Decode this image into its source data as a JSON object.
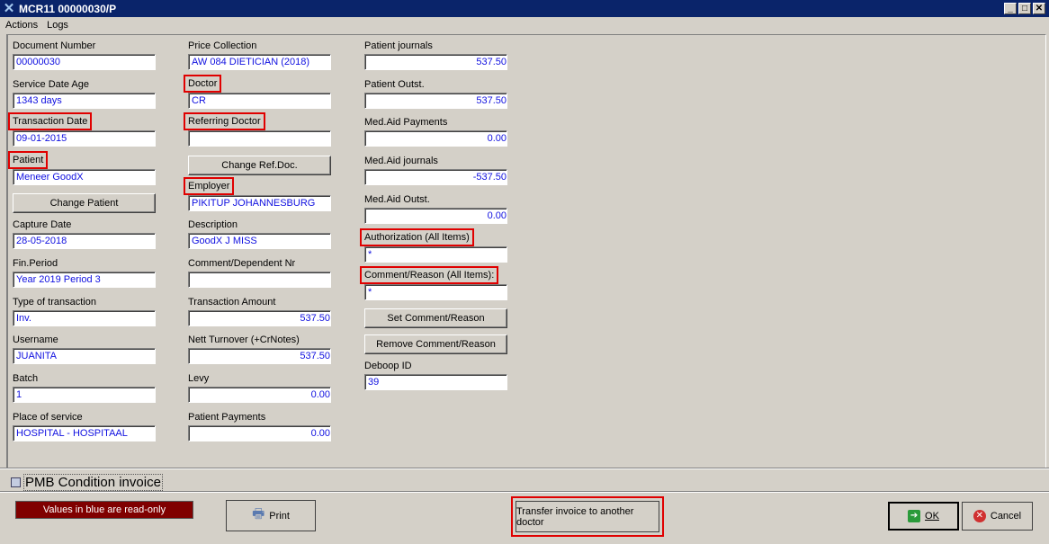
{
  "window": {
    "title": "MCR11 00000030/P",
    "minimize": "_",
    "restore": "□",
    "close": "✕"
  },
  "menu": [
    "Actions",
    "Logs"
  ],
  "col1": [
    {
      "label": "Document Number",
      "value": "00000030"
    },
    {
      "label": "Service Date Age",
      "value": "1343 days"
    },
    {
      "label": "Transaction Date",
      "value": "09-01-2015"
    },
    {
      "label": "Patient",
      "value": "Meneer GoodX"
    },
    {
      "label": "Capture Date",
      "value": "28-05-2018"
    },
    {
      "label": "Fin.Period",
      "value": "Year 2019 Period 3"
    },
    {
      "label": "Type of transaction",
      "value": "Inv."
    },
    {
      "label": "Username",
      "value": "JUANITA"
    },
    {
      "label": "Batch",
      "value": "1"
    },
    {
      "label": "Place of service",
      "value": "HOSPITAL - HOSPITAAL"
    }
  ],
  "col2": [
    {
      "label": "Price Collection",
      "value": "AW 084 DIETICIAN (2018)"
    },
    {
      "label": "Doctor",
      "value": "CR"
    },
    {
      "label": "Referring Doctor",
      "value": ""
    },
    {
      "label": "Employer",
      "value": "PIKITUP JOHANNESBURG"
    },
    {
      "label": "Description",
      "value": "GoodX J MISS"
    },
    {
      "label": "Comment/Dependent Nr",
      "value": ""
    },
    {
      "label": "Transaction Amount",
      "value": "537.50"
    },
    {
      "label": "Nett Turnover (+CrNotes)",
      "value": "537.50"
    },
    {
      "label": "Levy",
      "value": "0.00"
    },
    {
      "label": "Patient Payments",
      "value": "0.00"
    }
  ],
  "col3": [
    {
      "label": "Patient journals",
      "value": "537.50"
    },
    {
      "label": "Patient Outst.",
      "value": "537.50"
    },
    {
      "label": "Med.Aid Payments",
      "value": "0.00"
    },
    {
      "label": "Med.Aid journals",
      "value": "-537.50"
    },
    {
      "label": "Med.Aid Outst.",
      "value": "0.00"
    },
    {
      "label": "Authorization (All Items)",
      "value": "*"
    },
    {
      "label": "Comment/Reason (All Items):",
      "value": "*"
    },
    {
      "label": "Deboop ID",
      "value": "39"
    }
  ],
  "buttons": {
    "change_patient": "Change Patient",
    "change_ref_doc": "Change Ref.Doc.",
    "set_comment": "Set Comment/Reason",
    "remove_comment": "Remove Comment/Reason",
    "print": "Print",
    "transfer": "Transfer invoice to another doctor",
    "ok": "OK",
    "cancel": "Cancel"
  },
  "pmb_checkbox": {
    "label": "PMB Condition invoice",
    "checked": false
  },
  "readonly_notice": "Values in blue are read-only",
  "colors": {
    "highlight": "#e00000",
    "readonly_value": "#1010e0",
    "notice_bg": "#800000",
    "titlebar": "#0a246a"
  }
}
